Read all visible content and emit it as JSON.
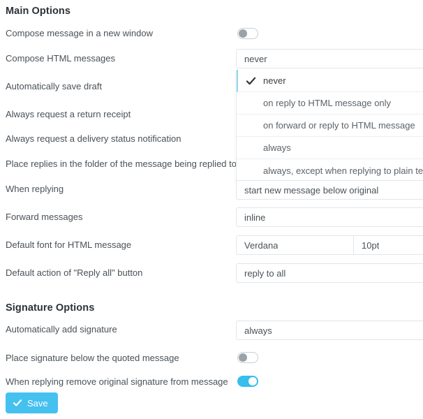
{
  "sections": {
    "main": {
      "title": "Main Options",
      "rows": [
        {
          "label": "Compose message in a new window",
          "control": "toggle",
          "value": "off"
        },
        {
          "label": "Compose HTML messages",
          "control": "select",
          "value": "never"
        },
        {
          "label": "Automatically save draft",
          "control": "select",
          "value": ""
        },
        {
          "label": "Always request a return receipt",
          "control": "select",
          "value": ""
        },
        {
          "label": "Always request a delivery status notification",
          "control": "select",
          "value": ""
        },
        {
          "label": "Place replies in the folder of the message being replied to",
          "control": "select",
          "value": ""
        },
        {
          "label": "When replying",
          "control": "select",
          "value": "start new message below original"
        },
        {
          "label": "Forward messages",
          "control": "select",
          "value": "inline"
        },
        {
          "label": "Default font for HTML message",
          "control": "select-split",
          "value": "Verdana",
          "value2": "10pt"
        },
        {
          "label": "Default action of \"Reply all\" button",
          "control": "select",
          "value": "reply to all"
        }
      ]
    },
    "signature": {
      "title": "Signature Options",
      "rows": [
        {
          "label": "Automatically add signature",
          "control": "select",
          "value": "always"
        },
        {
          "label": "Place signature below the quoted message",
          "control": "toggle",
          "value": "off"
        },
        {
          "label": "When replying remove original signature from message",
          "control": "toggle",
          "value": "on"
        }
      ]
    }
  },
  "dropdown": {
    "open": true,
    "belongs_to": "Compose HTML messages",
    "selected": "never",
    "options": [
      {
        "label": "never",
        "selected": true
      },
      {
        "label": "on reply to HTML message only",
        "selected": false
      },
      {
        "label": "on forward or reply to HTML message",
        "selected": false
      },
      {
        "label": "always",
        "selected": false
      },
      {
        "label": "always, except when replying to plain text",
        "selected": false
      }
    ]
  },
  "footer": {
    "save_label": "Save"
  },
  "colors": {
    "accent": "#37beec",
    "save_button": "#45c1f0",
    "label_text": "#4a5157",
    "heading_text": "#2b3238",
    "border": "#e2e6ea",
    "toggle_off_knob": "#9aa2aa",
    "dropdown_accent": "#8fd8f2"
  }
}
